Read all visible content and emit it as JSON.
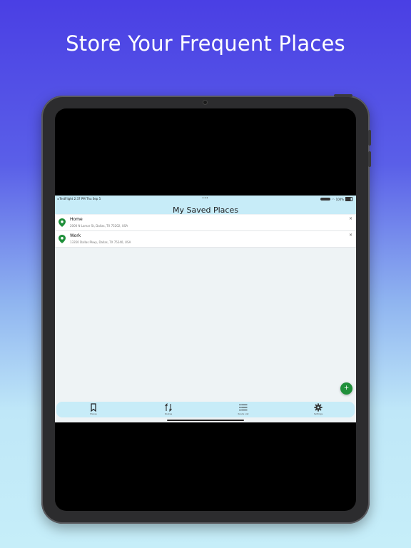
{
  "headline": "Store Your Frequent Places",
  "status_bar": {
    "left_text": "◂ TestFlight   2:37 PM   Thu Sep 5",
    "dots": "•••",
    "battery_text": "100%"
  },
  "nav": {
    "title": "My Saved Places"
  },
  "places": [
    {
      "name": "Home",
      "address": "2000 N Lamar St, Dallas, TX 75202, USA"
    },
    {
      "name": "Work",
      "address": "13350 Dallas Pkwy, Dallas, TX 75240, USA"
    }
  ],
  "fab": {
    "label": "+"
  },
  "tabs": [
    {
      "label": "Places",
      "icon": "bookmark-icon"
    },
    {
      "label": "Routes",
      "icon": "route-icon"
    },
    {
      "label": "Route List",
      "icon": "list-icon"
    },
    {
      "label": "Settings",
      "icon": "gear-icon"
    }
  ],
  "colors": {
    "accent_green": "#1f8f3a",
    "bar_background": "#c7ecf8",
    "gradient_top": "#4a3fe4",
    "gradient_bottom": "#c6eef9"
  }
}
